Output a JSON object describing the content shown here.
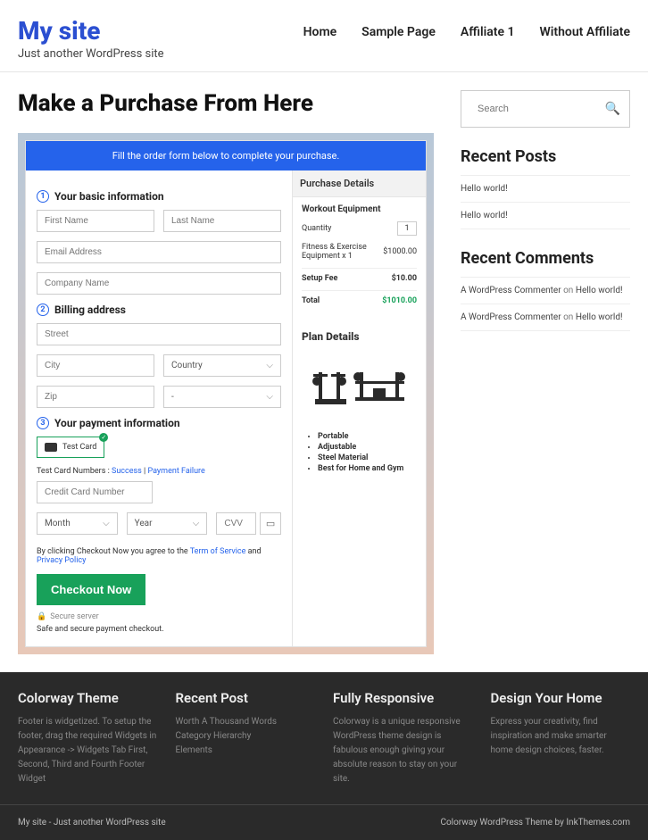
{
  "site": {
    "title": "My site",
    "tagline": "Just another WordPress site"
  },
  "nav": {
    "home": "Home",
    "sample": "Sample Page",
    "affiliate": "Affiliate 1",
    "without": "Without Affiliate"
  },
  "page": {
    "title": "Make a Purchase From Here",
    "banner": "Fill the order form below to complete your purchase."
  },
  "steps": {
    "s1": "Your basic information",
    "s2": "Billing address",
    "s3": "Your payment information"
  },
  "form": {
    "first_name": "First Name",
    "last_name": "Last Name",
    "email": "Email Address",
    "company": "Company Name",
    "street": "Street",
    "city": "City",
    "country": "Country",
    "zip": "Zip",
    "state_dash": "-",
    "test_card": "Test Card",
    "hint_prefix": "Test Card Numbers : ",
    "hint_success": "Success",
    "hint_sep": " | ",
    "hint_failure": "Payment Failure",
    "cc_number": "Credit Card Number",
    "month": "Month",
    "year": "Year",
    "cvv": "CVV",
    "terms_pre": "By clicking Checkout Now you agree to the ",
    "terms_tos": "Term of Service",
    "terms_and": " and ",
    "terms_pp": "Privacy Policy",
    "checkout_btn": "Checkout Now",
    "secure": "Secure server",
    "safe": "Safe and secure payment checkout."
  },
  "details": {
    "head": "Purchase Details",
    "item": "Workout Equipment",
    "qty_label": "Quantity",
    "qty_value": "1",
    "line_desc": "Fitness & Exercise Equipment x 1",
    "line_price": "$1000.00",
    "setup_label": "Setup Fee",
    "setup_price": "$10.00",
    "total_label": "Total",
    "total_price": "$1010.00"
  },
  "plan": {
    "title": "Plan Details",
    "features": {
      "f1": "Portable",
      "f2": "Adjustable",
      "f3": "Steel Material",
      "f4": "Best for Home and Gym"
    }
  },
  "sidebar": {
    "search_placeholder": "Search",
    "recent_posts_title": "Recent Posts",
    "post1": "Hello world!",
    "post2": "Hello world!",
    "recent_comments_title": "Recent Comments",
    "comment_author": "A WordPress Commenter",
    "comment_on": " on ",
    "comment_post": "Hello world!"
  },
  "footer": {
    "col1_title": "Colorway Theme",
    "col1_text": "Footer is widgetized. To setup the footer, drag the required Widgets in Appearance -> Widgets Tab First, Second, Third and Fourth Footer Widget",
    "col2_title": "Recent Post",
    "col2_l1": "Worth A Thousand Words",
    "col2_l2": "Category Hierarchy",
    "col2_l3": "Elements",
    "col3_title": "Fully Responsive",
    "col3_text": "Colorway is a unique responsive WordPress theme design is fabulous enough giving your absolute reason to stay on your site.",
    "col4_title": "Design Your Home",
    "col4_text": "Express your creativity, find inspiration and make smarter home design choices, faster.",
    "bar_left": "My site - Just another WordPress site",
    "bar_right": "Colorway WordPress Theme by InkThemes.com"
  }
}
